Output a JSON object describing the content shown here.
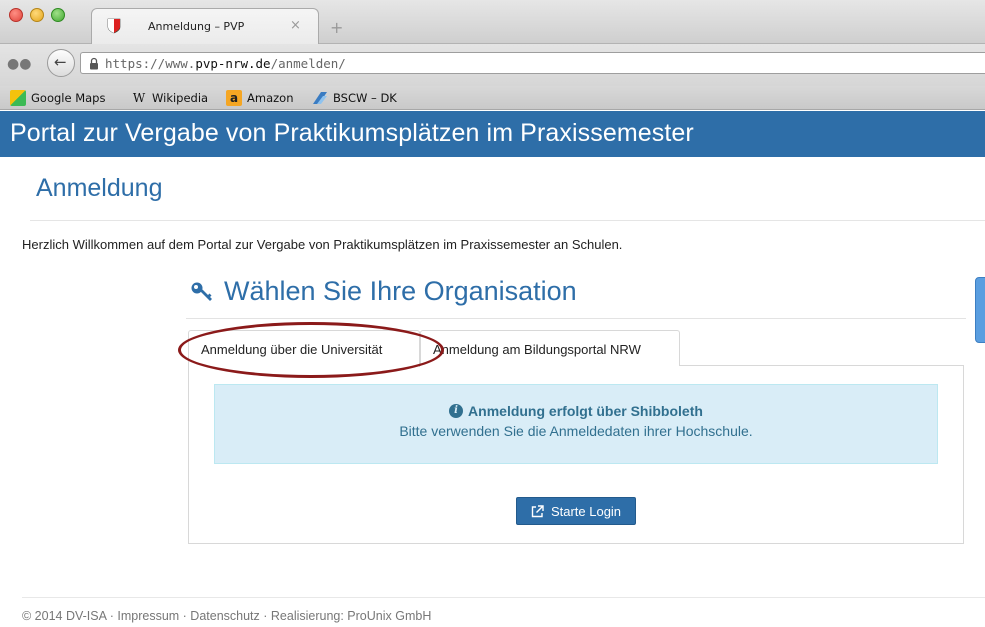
{
  "browser": {
    "tab_title": "Anmeldung – PVP",
    "tab_close": "×",
    "new_tab": "+",
    "url_prefix": "https://www.",
    "url_domain": "pvp-nrw.de",
    "url_path": "/anmelden/",
    "bookmarks": [
      {
        "label": "Google Maps",
        "icon": "google-maps-icon"
      },
      {
        "label": "Wikipedia",
        "icon": "wikipedia-icon"
      },
      {
        "label": "Amazon",
        "icon": "amazon-icon"
      },
      {
        "label": "BSCW – DK",
        "icon": "bscw-icon"
      }
    ]
  },
  "site": {
    "title": "Portal zur Vergabe von Praktikumsplätzen im Praxissemester"
  },
  "page": {
    "title": "Anmeldung",
    "welcome": "Herzlich Willkommen auf dem Portal zur Vergabe von Praktikumsplätzen im Praxissemester an Schulen.",
    "org_heading": "Wählen Sie Ihre Organisation",
    "tabs": [
      {
        "label": "Anmeldung über die Universität",
        "active": true
      },
      {
        "label": "Anmeldung am Bildungsportal NRW",
        "active": false
      }
    ],
    "info": {
      "title": "Anmeldung erfolgt über Shibboleth",
      "text": "Bitte verwenden Sie die Anmeldedaten ihrer Hochschule."
    },
    "login_button": "Starte Login"
  },
  "footer": {
    "text": "© 2014 DV-ISA · Impressum · Datenschutz · Realisierung: ProUnix GmbH"
  },
  "colors": {
    "brand_blue": "#2e6ea8",
    "info_bg": "#d9edf7",
    "info_text": "#31708f",
    "highlight": "#8b1a1a"
  }
}
